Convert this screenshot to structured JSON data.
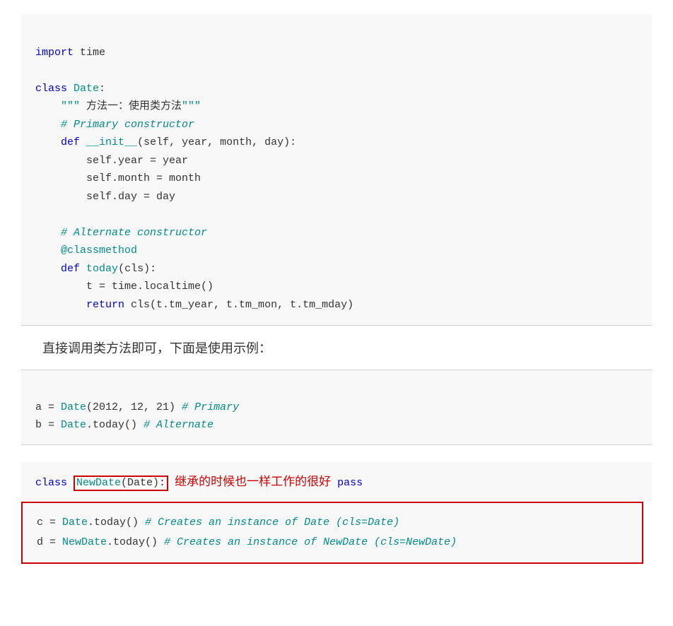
{
  "code_block_1": {
    "lines": [
      {
        "tokens": [
          {
            "text": "import",
            "class": "kw"
          },
          {
            "text": " time",
            "class": "nm"
          }
        ]
      },
      {
        "tokens": []
      },
      {
        "tokens": [
          {
            "text": "class",
            "class": "kw"
          },
          {
            "text": " ",
            "class": "nm"
          },
          {
            "text": "Date",
            "class": "cn"
          },
          {
            "text": ":",
            "class": "nm"
          }
        ]
      },
      {
        "tokens": [
          {
            "text": "    \"\"\"",
            "class": "st"
          },
          {
            "text": " 方法一：使用类方法",
            "class": "nm"
          },
          {
            "text": "\"\"\"",
            "class": "st"
          }
        ]
      },
      {
        "tokens": [
          {
            "text": "    # Primary constructor",
            "class": "cm"
          }
        ]
      },
      {
        "tokens": [
          {
            "text": "    ",
            "class": "nm"
          },
          {
            "text": "def",
            "class": "kw"
          },
          {
            "text": " ",
            "class": "nm"
          },
          {
            "text": "__init__",
            "class": "cn"
          },
          {
            "text": "(self, year, month, day):",
            "class": "nm"
          }
        ]
      },
      {
        "tokens": [
          {
            "text": "        self",
            "class": "nm"
          },
          {
            "text": ".year = year",
            "class": "nm"
          }
        ]
      },
      {
        "tokens": [
          {
            "text": "        self",
            "class": "nm"
          },
          {
            "text": ".month = month",
            "class": "nm"
          }
        ]
      },
      {
        "tokens": [
          {
            "text": "        self",
            "class": "nm"
          },
          {
            "text": ".day = day",
            "class": "nm"
          }
        ]
      },
      {
        "tokens": []
      },
      {
        "tokens": [
          {
            "text": "    # Alternate constructor",
            "class": "cm"
          }
        ]
      },
      {
        "tokens": [
          {
            "text": "    ",
            "class": "nm"
          },
          {
            "text": "@classmethod",
            "class": "dec"
          }
        ]
      },
      {
        "tokens": [
          {
            "text": "    ",
            "class": "nm"
          },
          {
            "text": "def",
            "class": "kw"
          },
          {
            "text": " ",
            "class": "nm"
          },
          {
            "text": "today",
            "class": "cn"
          },
          {
            "text": "(cls):",
            "class": "nm"
          }
        ]
      },
      {
        "tokens": [
          {
            "text": "        t = time.localtime()",
            "class": "nm"
          }
        ]
      },
      {
        "tokens": [
          {
            "text": "        ",
            "class": "nm"
          },
          {
            "text": "return",
            "class": "kw"
          },
          {
            "text": " cls(t.tm_year, t.tm_mon, t.tm_mday)",
            "class": "nm"
          }
        ]
      }
    ]
  },
  "prose_1": "直接调用类方法即可，下面是使用示例：",
  "code_block_2": {
    "lines": [
      "a = Date(2012, 12, 21) # Primary",
      "b = Date.today() # Alternate"
    ]
  },
  "class_annotation": "继承的时候也一样工作的很好",
  "last_lines": {
    "line1_code": "c = Date.today()",
    "line1_comment": " # Creates an instance of Date (cls=Date)",
    "line2_code": "d = NewDate.today()",
    "line2_comment": " # Creates an instance of NewDate (cls=NewDate)"
  }
}
